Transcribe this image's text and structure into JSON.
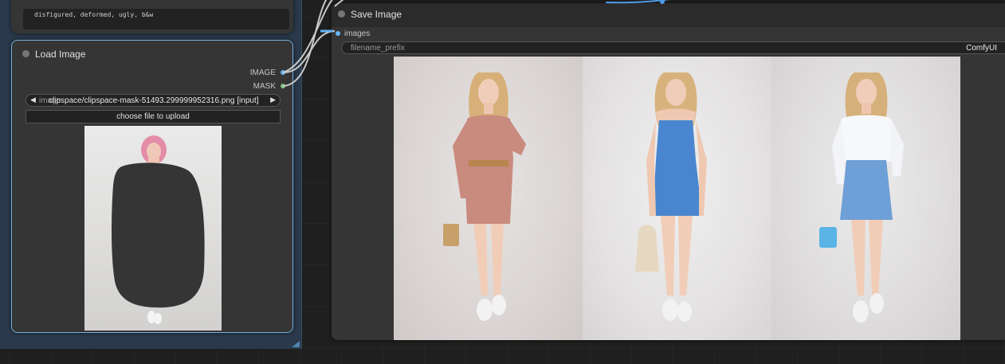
{
  "prompt_node": {
    "text": "disfigured, deformed, ugly, b&w"
  },
  "load_image_node": {
    "title": "Load Image",
    "outputs": [
      {
        "label": "IMAGE",
        "color": "#64b5f6"
      },
      {
        "label": "MASK",
        "color": "#81c784"
      }
    ],
    "image_widget": {
      "label": "image",
      "value": "clipspace/clipspace-mask-51493.299999952316.png [input]",
      "prev_arrow": "◀",
      "next_arrow": "▶"
    },
    "upload_button": "choose file to upload"
  },
  "save_image_node": {
    "title": "Save Image",
    "input": {
      "label": "images",
      "color": "#64b5f6"
    },
    "filename_prefix": {
      "label": "filename_prefix",
      "value": "ComfyUI"
    }
  },
  "gallery": {
    "images": [
      {
        "outfit": "pink shirt dress with belt",
        "dress_color": "#c98b7e",
        "bag_color": "#c8a06a"
      },
      {
        "outfit": "blue strapless dress",
        "dress_color": "#4a86cf",
        "bag_color": "#e6d8c0"
      },
      {
        "outfit": "white blouse and blue denim skirt",
        "dress_color": "#6e9fd6",
        "bag_color": "#5ab4e6"
      }
    ]
  },
  "colors": {
    "link": "#c8c8c8",
    "node_bg": "#353535",
    "selected_border": "#79b0db",
    "group_bg": "#2a3a4c"
  }
}
